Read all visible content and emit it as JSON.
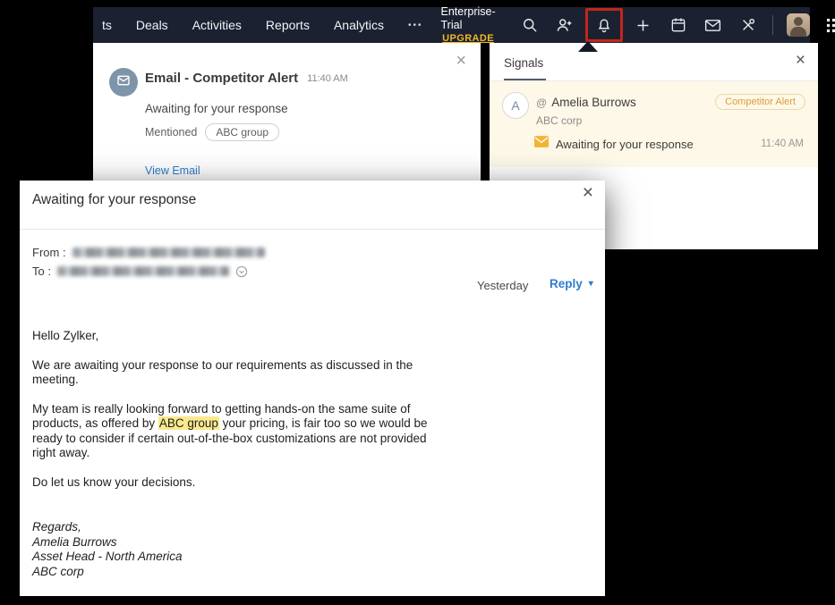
{
  "colors": {
    "nav_bg": "#1b2130",
    "upgrade_gold": "#f2b624",
    "link_blue": "#2e7cd0",
    "badge_orange": "#dd9c3a",
    "highlight_yellow": "#fbe98e",
    "signal_row_bg": "#fdf8e7",
    "annotation_red": "#c1271b"
  },
  "nav": {
    "items": [
      {
        "label": "ts"
      },
      {
        "label": "Deals"
      },
      {
        "label": "Activities"
      },
      {
        "label": "Reports"
      },
      {
        "label": "Analytics"
      }
    ],
    "more": "•••",
    "plan_name": "Enterprise-Trial",
    "upgrade_label": "UPGRADE"
  },
  "alert_card": {
    "title": "Email - Competitor Alert",
    "time": "11:40 AM",
    "subject": "Awaiting for your response",
    "mentioned_label": "Mentioned",
    "mention_chip": "ABC group",
    "view_email_link": "View Email",
    "close": "×"
  },
  "signals_panel": {
    "title": "Signals",
    "close": "×",
    "item": {
      "avatar_letter": "A",
      "mention_symbol": "@",
      "name": "Amelia Burrows",
      "badge": "Competitor Alert",
      "company": "ABC corp",
      "subject": "Awaiting for your response",
      "time": "11:40 AM"
    }
  },
  "email_modal": {
    "title": "Awaiting for your response",
    "close": "×",
    "from_label": "From :",
    "to_label": "To :",
    "date_label": "Yesterday",
    "reply_label": "Reply",
    "reply_caret": "▾",
    "body": {
      "greeting": "Hello Zylker,",
      "para1": "We are awaiting your response to our requirements as discussed in the meeting.",
      "para2_pre": "My team is really looking forward to getting hands-on the same suite of products, as offered by ",
      "para2_highlight": "ABC group",
      "para2_post": " your pricing, is fair too so we would be ready to consider if certain out-of-the-box customizations are not provided right away.",
      "para3": "Do let us know your decisions.",
      "signature": [
        "Regards,",
        "Amelia Burrows",
        "Asset Head - North America",
        "ABC corp"
      ]
    }
  }
}
